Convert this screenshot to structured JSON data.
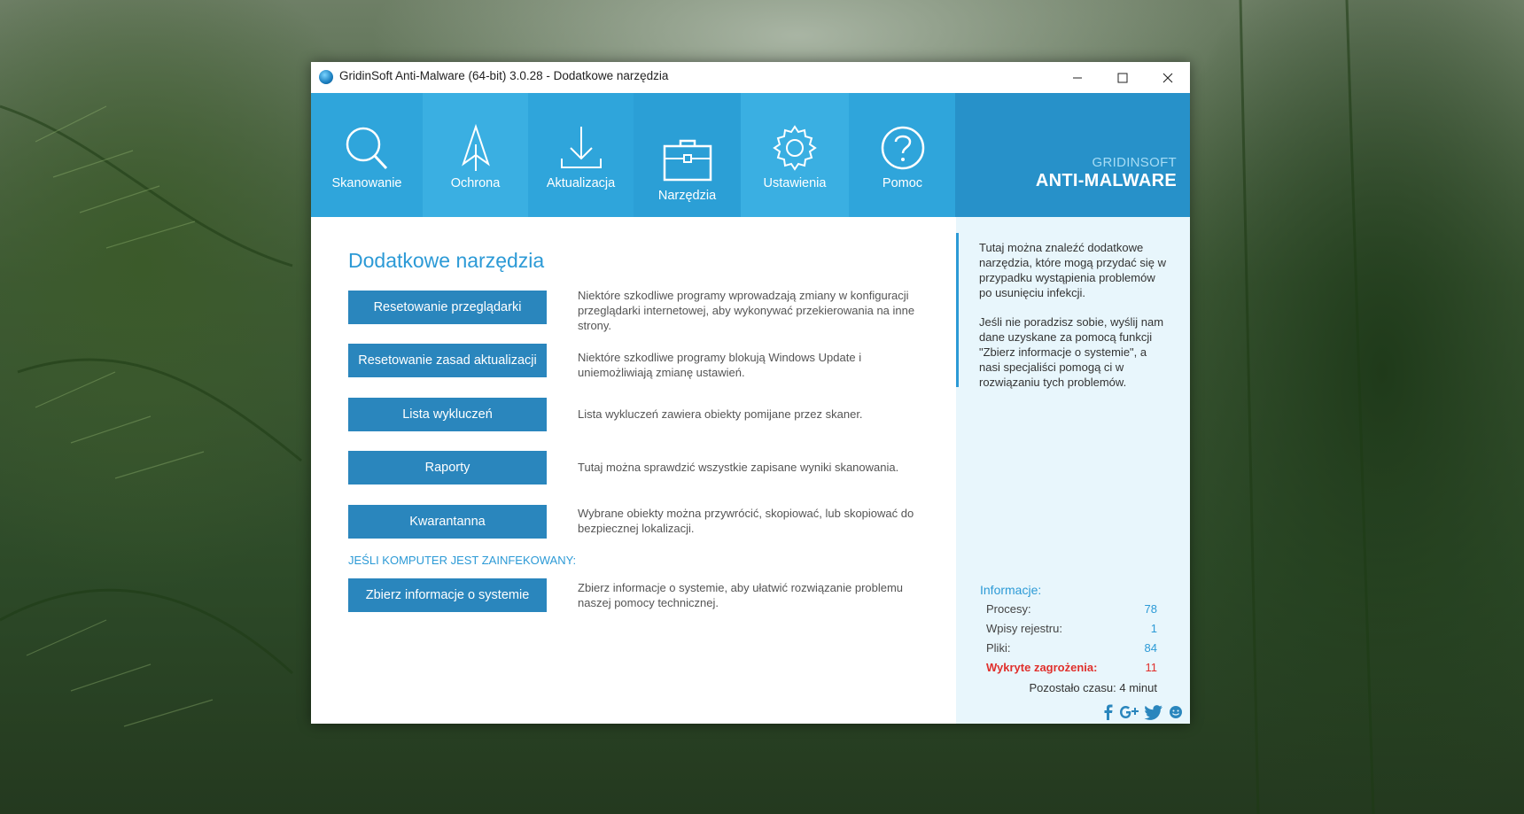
{
  "window": {
    "title": "GridinSoft Anti-Malware (64-bit) 3.0.28 - Dodatkowe narzędzia"
  },
  "nav": {
    "items": [
      {
        "label": "Skanowanie",
        "icon": "magnifier-icon"
      },
      {
        "label": "Ochrona",
        "icon": "shield-arrow-icon"
      },
      {
        "label": "Aktualizacja",
        "icon": "download-icon"
      },
      {
        "label": "Narzędzia",
        "icon": "toolbox-icon"
      },
      {
        "label": "Ustawienia",
        "icon": "gear-icon"
      },
      {
        "label": "Pomoc",
        "icon": "help-circle-icon"
      }
    ],
    "active": "Narzędzia"
  },
  "brand": {
    "top": "GRIDINSOFT",
    "main": "ANTI-MALWARE"
  },
  "main": {
    "title": "Dodatkowe narzędzia",
    "tools": [
      {
        "label": "Resetowanie przeglądarki",
        "desc": "Niektóre szkodliwe programy wprowadzają zmiany w konfiguracji przeglądarki internetowej, aby wykonywać przekierowania na inne strony."
      },
      {
        "label": "Resetowanie zasad aktualizacji",
        "desc": "Niektóre szkodliwe programy blokują Windows Update i uniemożliwiają zmianę ustawień."
      },
      {
        "label": "Lista wykluczeń",
        "desc": "Lista wykluczeń zawiera obiekty pomijane przez skaner."
      },
      {
        "label": "Raporty",
        "desc": "Tutaj można sprawdzić wszystkie zapisane wyniki skanowania."
      },
      {
        "label": "Kwarantanna",
        "desc": "Wybrane obiekty można przywrócić, skopiować, lub skopiować do bezpiecznej lokalizacji."
      }
    ],
    "infected_label": "JEŚLI KOMPUTER JEST ZAINFEKOWANY:",
    "collect": {
      "label": "Zbierz informacje o systemie",
      "desc": "Zbierz informacje o systemie, aby ułatwić rozwiązanie problemu naszej pomocy technicznej."
    }
  },
  "sidebar": {
    "text1": "Tutaj można znaleźć dodatkowe narzędzia, które mogą przydać się w przypadku wystąpienia problemów po usunięciu infekcji.",
    "text2": "Jeśli nie poradzisz sobie, wyślij nam dane uzyskane za pomocą funkcji \"Zbierz informacje o systemie\", a nasi specjaliści pomogą ci w rozwiązaniu tych problemów.",
    "info_title": "Informacje:",
    "stats": [
      {
        "label": "Procesy:",
        "value": "78"
      },
      {
        "label": "Wpisy rejestru:",
        "value": "1"
      },
      {
        "label": "Pliki:",
        "value": "84"
      },
      {
        "label": "Wykryte zagrożenia:",
        "value": "11"
      }
    ],
    "time_left": "Pozostało czasu: 4 minut",
    "social": [
      "facebook-icon",
      "google-plus-icon",
      "twitter-icon",
      "feedback-icon"
    ]
  },
  "colors": {
    "nav_bg": "#2fa5db",
    "brand_bg": "#2791c9",
    "button_bg": "#2a86bd",
    "accent": "#2c9ad6",
    "threat": "#e0302c",
    "sidebar_bg": "#e8f6fc"
  }
}
